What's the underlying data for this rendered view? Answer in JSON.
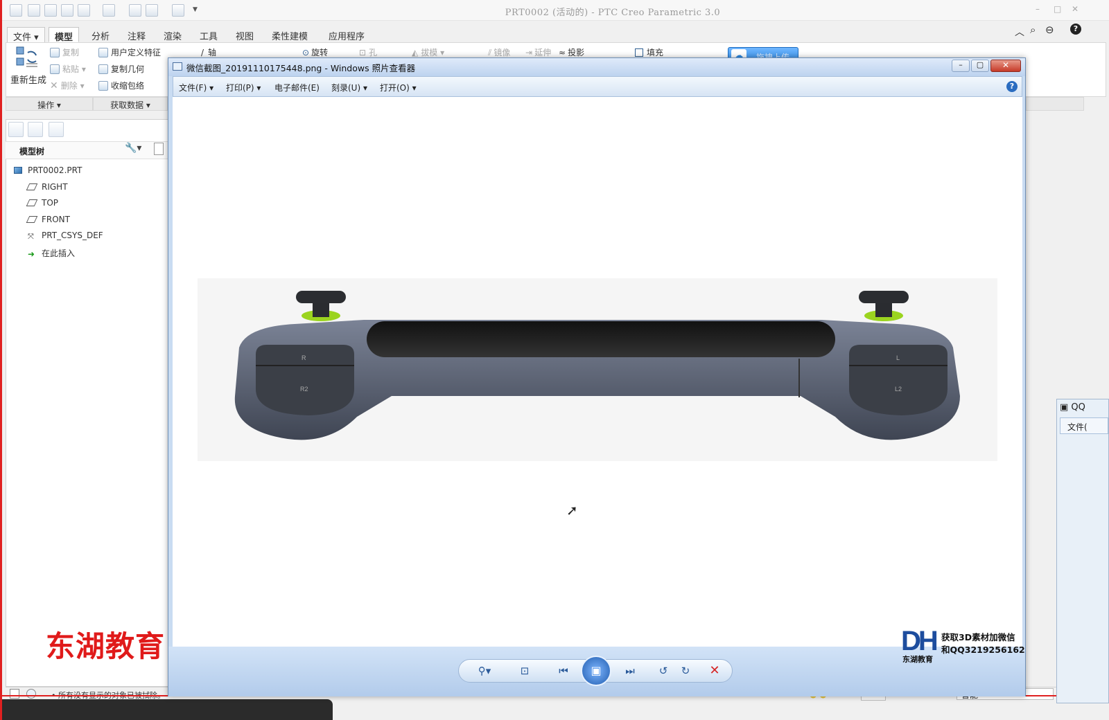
{
  "app": {
    "title": "PRT0002 (活动的) - PTC Creo Parametric 3.0",
    "window_controls": [
      "–",
      "□",
      "✕"
    ]
  },
  "menu": {
    "tabs": [
      "文件",
      "模型",
      "分析",
      "注释",
      "渲染",
      "工具",
      "视图",
      "柔性建模",
      "应用程序"
    ],
    "active_tab": "模型"
  },
  "ribbon": {
    "regenerate": "重新生成",
    "copy": "复制",
    "paste": "粘贴",
    "delete": "删除",
    "user_feature": "用户定义特征",
    "copy_geometry": "复制几何",
    "shrinkwrap": "收缩包络",
    "axis": "轴",
    "revolve": "旋转",
    "hole": "孔",
    "draft": "拔模",
    "mirror": "镜像",
    "extend": "延伸",
    "project": "投影",
    "fill": "填充",
    "group_operations": "操作",
    "group_get_data": "获取数据"
  },
  "model_tree": {
    "title": "模型树",
    "items": [
      {
        "label": "PRT0002.PRT",
        "icon": "part-icon"
      },
      {
        "label": "RIGHT",
        "icon": "datum-plane-icon"
      },
      {
        "label": "TOP",
        "icon": "datum-plane-icon"
      },
      {
        "label": "FRONT",
        "icon": "datum-plane-icon"
      },
      {
        "label": "PRT_CSYS_DEF",
        "icon": "csys-icon"
      },
      {
        "label": "在此插入",
        "icon": "insert-arrow-icon"
      }
    ]
  },
  "status": {
    "message": "所有没有显示的对象已被拭除。",
    "filter": "智能"
  },
  "watermark": "东湖教育",
  "upload_button": "拖拽上传",
  "viewer": {
    "title": "微信截图_20191110175448.png - Windows 照片查看器",
    "menu": [
      "文件(F)",
      "打印(P)",
      "电子邮件(E)",
      "刻录(U)",
      "打开(O)"
    ],
    "image_labels": {
      "left_top": "R",
      "left_bottom": "R2",
      "right_top": "L",
      "right_bottom": "L2"
    }
  },
  "brand": {
    "logo": "DH",
    "logo_sub": "东湖教育",
    "line1": "获取3D素材加微信",
    "line2": "和QQ3219256162"
  },
  "qq_window": {
    "title": "QQ",
    "menu": "文件("
  },
  "colors": {
    "accent": "#2a86e0",
    "watermark": "#e01a1a",
    "controller_body": "#5a6170",
    "thumbstick": "#9bd41f"
  }
}
